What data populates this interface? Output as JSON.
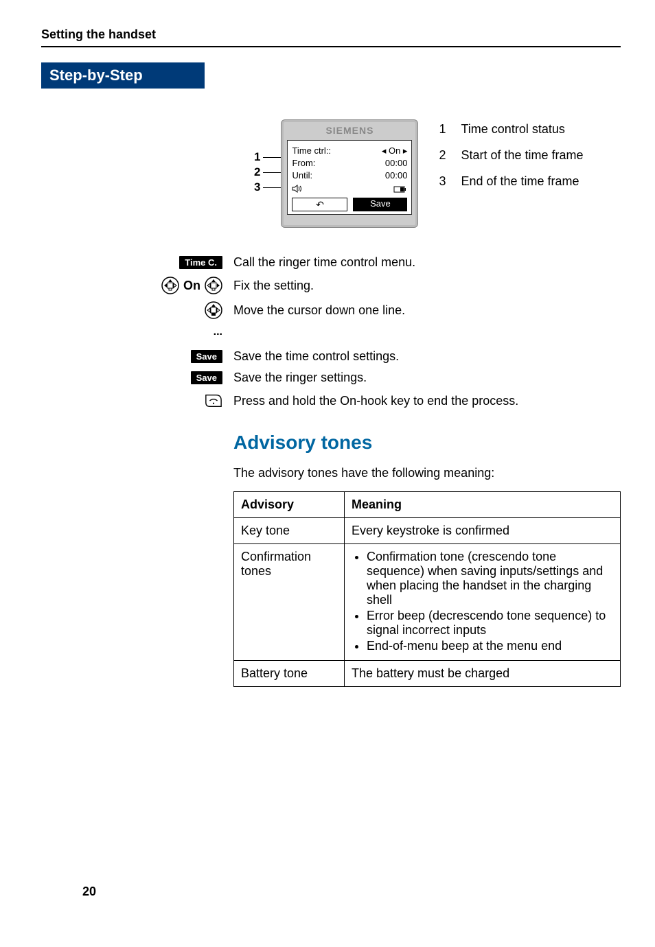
{
  "header": "Setting the handset",
  "sidebar": {
    "banner": "Step-by-Step"
  },
  "phone": {
    "brand": "SIEMENS",
    "rows": [
      {
        "label": "Time ctrl::",
        "value": "◂ On ▸"
      },
      {
        "label": "From:",
        "value": "00:00"
      },
      {
        "label": "Until:",
        "value": "00:00"
      }
    ],
    "soft_left_glyph": "↶",
    "soft_right": "Save",
    "leaders": [
      "1",
      "2",
      "3"
    ]
  },
  "legend": [
    {
      "n": "1",
      "text": "Time control status"
    },
    {
      "n": "2",
      "text": "Start of the time frame"
    },
    {
      "n": "3",
      "text": "End of the time frame"
    }
  ],
  "steps": [
    {
      "left_type": "mini",
      "left_text": "Time C.",
      "right": "Call the ringer time control menu."
    },
    {
      "left_type": "on",
      "left_text": "On",
      "right": "Fix the setting."
    },
    {
      "left_type": "nav",
      "right": "Move the cursor down one line."
    },
    {
      "left_type": "dots",
      "left_text": "...",
      "right": ""
    },
    {
      "left_type": "mini",
      "left_text": "Save",
      "right": "Save the time control settings."
    },
    {
      "left_type": "mini",
      "left_text": "Save",
      "right": "Save the ringer settings."
    },
    {
      "left_type": "hook",
      "right": "Press and hold the On-hook key to end the process."
    }
  ],
  "section_title": "Advisory tones",
  "intro": "The advisory tones have the following meaning:",
  "table": {
    "headers": [
      "Advisory",
      "Meaning"
    ],
    "rows": [
      {
        "c1": "Key tone",
        "c2_type": "text",
        "c2": "Every keystroke is confirmed"
      },
      {
        "c1": "Confirmation tones",
        "c2_type": "list",
        "c2": [
          "Confirmation tone (crescendo tone sequence) when saving inputs/settings and when placing the handset in the charging shell",
          "Error beep (decrescendo tone sequence) to signal incorrect inputs",
          "End-of-menu beep at the menu end"
        ]
      },
      {
        "c1": "Battery tone",
        "c2_type": "text",
        "c2": "The battery must be charged"
      }
    ]
  },
  "page_number": "20"
}
